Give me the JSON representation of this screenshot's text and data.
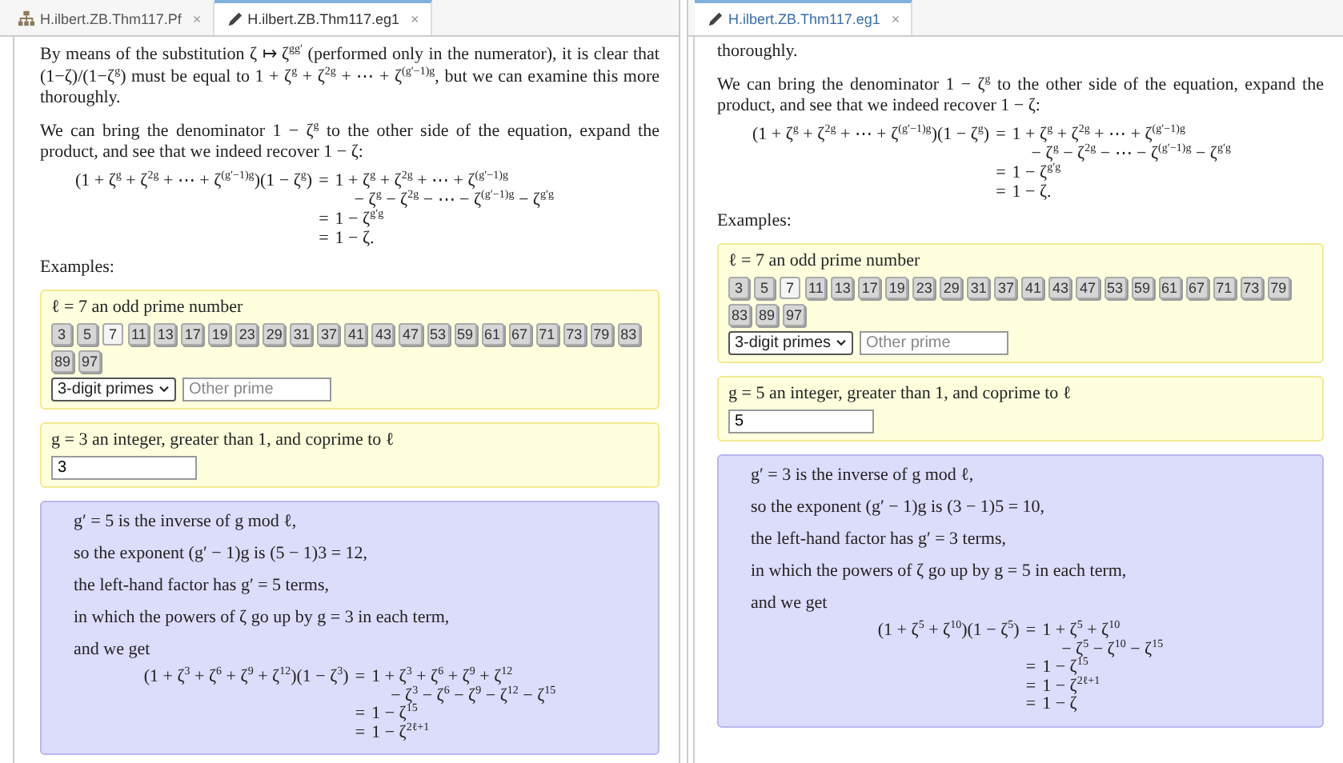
{
  "panes": [
    {
      "tabs": [
        {
          "kind": "outline",
          "label": "H.ilbert.ZB.Thm117.Pf",
          "close": "×",
          "selected": false
        },
        {
          "kind": "editor",
          "label": "H.ilbert.ZB.Thm117.eg1",
          "close": "×",
          "selected": true
        }
      ],
      "paragraphs": [
        "By means of the substitution ζ ↦ ζ$^{gg′}$ (performed only in the numerator), it is clear that (1−ζ)/(1−ζ$^{g}$) must be equal to 1 + ζ$^{g}$ + ζ$^{2g}$ + ⋯ + ζ$^{(g′−1)g}$, but we can examine this more thoroughly.",
        "We can bring the denominator 1 − ζ$^{g}$ to the other side of the equation, expand the product, and see that we indeed recover 1 − ζ:"
      ],
      "equation": {
        "lhs": "(1 + ζ$^{g}$ + ζ$^{2g}$ + ⋯ + ζ$^{(g′−1)g}$)(1 − ζ$^{g}$)",
        "rows": [
          {
            "kind": "relation",
            "rel": "=",
            "rhs": "1 + ζ$^{g}$ + ζ$^{2g}$ + ⋯ + ζ$^{(g′−1)g}$"
          },
          {
            "kind": "continuation",
            "rhs": "− ζ$^{g}$ − ζ$^{2g}$ − ⋯ − ζ$^{(g′−1)g}$ − ζ$^{g′g}$"
          },
          {
            "kind": "relation",
            "rel": "=",
            "rhs": "1 − ζ$^{g′g}$"
          },
          {
            "kind": "relation",
            "rel": "=",
            "rhs": "1 − ζ."
          }
        ]
      },
      "examples_label": "Examples:",
      "ell_box": {
        "label": "ℓ = 7 an odd prime number",
        "primes": [
          {
            "value": "3",
            "selected": false
          },
          {
            "value": "5",
            "selected": false
          },
          {
            "value": "7",
            "selected": true
          },
          {
            "value": "11",
            "selected": false
          },
          {
            "value": "13",
            "selected": false
          },
          {
            "value": "17",
            "selected": false
          },
          {
            "value": "19",
            "selected": false
          },
          {
            "value": "23",
            "selected": false
          },
          {
            "value": "29",
            "selected": false
          },
          {
            "value": "31",
            "selected": false
          },
          {
            "value": "37",
            "selected": false
          },
          {
            "value": "41",
            "selected": false
          },
          {
            "value": "43",
            "selected": false
          },
          {
            "value": "47",
            "selected": false
          },
          {
            "value": "53",
            "selected": false
          },
          {
            "value": "59",
            "selected": false
          },
          {
            "value": "61",
            "selected": false
          },
          {
            "value": "67",
            "selected": false
          },
          {
            "value": "71",
            "selected": false
          },
          {
            "value": "73",
            "selected": false
          },
          {
            "value": "79",
            "selected": false
          },
          {
            "value": "83",
            "selected": false
          },
          {
            "value": "89",
            "selected": false
          },
          {
            "value": "97",
            "selected": false
          }
        ],
        "select": "3-digit primes",
        "other_placeholder": "Other prime"
      },
      "g_box": {
        "label": "g = 3 an integer, greater than 1, and coprime to ℓ",
        "value": "3"
      },
      "result_box": {
        "lines": [
          "g′ = 5 is the inverse of g mod ℓ,",
          "so the exponent (g′ − 1)g is (5 − 1)3 = 12,",
          "the left-hand factor has g′ = 5 terms,",
          "in which the powers of ζ go up by g = 3 in each term,",
          "and we get"
        ],
        "equation": {
          "lhs": "(1 + ζ$^{3}$ + ζ$^{6}$ + ζ$^{9}$ + ζ$^{12}$)(1 − ζ$^{3}$)",
          "rows": [
            {
              "kind": "relation",
              "rel": "=",
              "rhs": "1 + ζ$^{3}$ + ζ$^{6}$ + ζ$^{9}$ + ζ$^{12}$"
            },
            {
              "kind": "continuation",
              "rhs": "− ζ$^{3}$ − ζ$^{6}$ − ζ$^{9}$ − ζ$^{12}$ − ζ$^{15}$"
            },
            {
              "kind": "relation",
              "rel": "=",
              "rhs": "1 − ζ$^{15}$"
            },
            {
              "kind": "relation",
              "rel": "=",
              "rhs": "1 − ζ$^{2ℓ+1}$"
            }
          ]
        }
      }
    },
    {
      "tabs": [
        {
          "kind": "editor",
          "label": "H.ilbert.ZB.Thm117.eg1",
          "close": "×",
          "selected": true
        }
      ],
      "paragraphs": [
        "thoroughly.",
        "We can bring the denominator 1 − ζ$^{g}$ to the other side of the equation, expand the product, and see that we indeed recover 1 − ζ:"
      ],
      "equation": {
        "lhs": "(1 + ζ$^{g}$ + ζ$^{2g}$ + ⋯ + ζ$^{(g′−1)g}$)(1 − ζ$^{g}$)",
        "rows": [
          {
            "kind": "relation",
            "rel": "=",
            "rhs": "1 + ζ$^{g}$ + ζ$^{2g}$ + ⋯ + ζ$^{(g′−1)g}$"
          },
          {
            "kind": "continuation",
            "rhs": "− ζ$^{g}$ − ζ$^{2g}$ − ⋯ − ζ$^{(g′−1)g}$ − ζ$^{g′g}$"
          },
          {
            "kind": "relation",
            "rel": "=",
            "rhs": "1 − ζ$^{g′g}$"
          },
          {
            "kind": "relation",
            "rel": "=",
            "rhs": "1 − ζ."
          }
        ]
      },
      "examples_label": "Examples:",
      "ell_box": {
        "label": "ℓ = 7 an odd prime number",
        "primes": [
          {
            "value": "3",
            "selected": false
          },
          {
            "value": "5",
            "selected": false
          },
          {
            "value": "7",
            "selected": true
          },
          {
            "value": "11",
            "selected": false
          },
          {
            "value": "13",
            "selected": false
          },
          {
            "value": "17",
            "selected": false
          },
          {
            "value": "19",
            "selected": false
          },
          {
            "value": "23",
            "selected": false
          },
          {
            "value": "29",
            "selected": false
          },
          {
            "value": "31",
            "selected": false
          },
          {
            "value": "37",
            "selected": false
          },
          {
            "value": "41",
            "selected": false
          },
          {
            "value": "43",
            "selected": false
          },
          {
            "value": "47",
            "selected": false
          },
          {
            "value": "53",
            "selected": false
          },
          {
            "value": "59",
            "selected": false
          },
          {
            "value": "61",
            "selected": false
          },
          {
            "value": "67",
            "selected": false
          },
          {
            "value": "71",
            "selected": false
          },
          {
            "value": "73",
            "selected": false
          },
          {
            "value": "79",
            "selected": false
          },
          {
            "value": "83",
            "selected": false
          },
          {
            "value": "89",
            "selected": false
          },
          {
            "value": "97",
            "selected": false
          }
        ],
        "select": "3-digit primes",
        "other_placeholder": "Other prime"
      },
      "g_box": {
        "label": "g = 5 an integer, greater than 1, and coprime to ℓ",
        "value": "5"
      },
      "result_box": {
        "lines": [
          "g′ = 3 is the inverse of g mod ℓ,",
          "so the exponent (g′ − 1)g is (3 − 1)5 = 10,",
          "the left-hand factor has g′ = 3 terms,",
          "in which the powers of ζ go up by g = 5 in each term,",
          "and we get"
        ],
        "equation": {
          "lhs": "(1 + ζ$^{5}$ + ζ$^{10}$)(1 − ζ$^{5}$)",
          "rows": [
            {
              "kind": "relation",
              "rel": "=",
              "rhs": "1 + ζ$^{5}$ + ζ$^{10}$"
            },
            {
              "kind": "continuation",
              "rhs": "− ζ$^{5}$ − ζ$^{10}$ − ζ$^{15}$"
            },
            {
              "kind": "relation",
              "rel": "=",
              "rhs": "1 − ζ$^{15}$"
            },
            {
              "kind": "relation",
              "rel": "=",
              "rhs": "1 − ζ$^{2ℓ+1}$"
            },
            {
              "kind": "relation",
              "rel": "=",
              "rhs": "1 − ζ"
            }
          ]
        }
      }
    }
  ]
}
